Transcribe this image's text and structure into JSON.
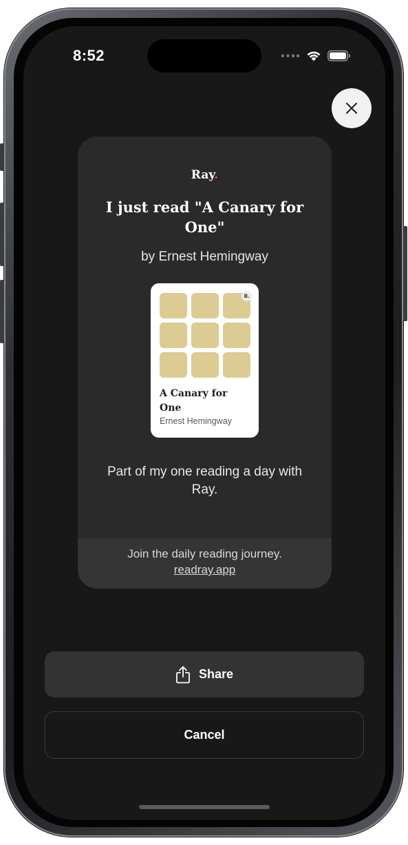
{
  "status_bar": {
    "time": "8:52",
    "icons": [
      "signal-dots-icon",
      "wifi-icon",
      "battery-icon"
    ]
  },
  "close_button": {
    "icon": "close-icon"
  },
  "share_card": {
    "brand": "Ray",
    "brand_dot": ".",
    "brand_dot_color": "#e0506a",
    "title": "I just read \"A Canary for One\"",
    "author": "by Ernest Hemingway",
    "book": {
      "mini_logo": "R.",
      "title": "A Canary for One",
      "author": "Ernest Hemingway",
      "tile_color": "#dccb92",
      "tile_count": 9
    },
    "message": "Part of my one reading a day with Ray.",
    "footer_text": "Join the daily reading journey.",
    "footer_link": "readray.app"
  },
  "actions": {
    "share_label": "Share",
    "share_icon": "share-icon",
    "cancel_label": "Cancel"
  },
  "colors": {
    "screen_background": "#181818",
    "card_background": "#2a2a2a",
    "card_footer_background": "#353535",
    "share_button_background": "#333333"
  }
}
